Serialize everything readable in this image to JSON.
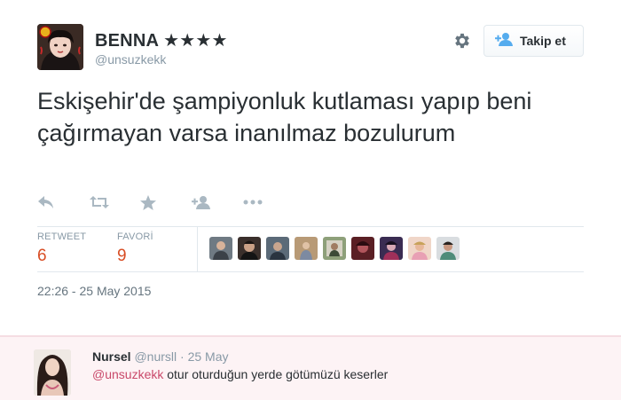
{
  "tweet": {
    "author_name": "BENNA ★★★★",
    "author_handle": "@unsuzkekk",
    "follow_label": "Takip et",
    "text": "Eskişehir'de şampiyonluk kutlaması yapıp beni çağırmayan varsa inanılmaz bozulurum",
    "actions": [
      "reply-icon",
      "retweet-icon",
      "favorite-icon",
      "follow-icon",
      "more-icon"
    ],
    "stats": {
      "retweet_label": "RETWEET",
      "retweet_count": "6",
      "favorite_label": "FAVORİ",
      "favorite_count": "9"
    },
    "favoriters_count": 9,
    "timestamp": "22:26 - 25 May 2015"
  },
  "reply": {
    "author_name": "Nursel",
    "author_handle": "@nursll",
    "separator": "·",
    "date": "25 May",
    "mention": "@unsuzkekk",
    "text": " otur oturduğun yerde götümüzü keserler"
  },
  "colors": {
    "stat_value": "#d84d24",
    "mention": "#c9496a",
    "icon_gray": "#aab8c2",
    "follow_icon": "#55acee"
  }
}
